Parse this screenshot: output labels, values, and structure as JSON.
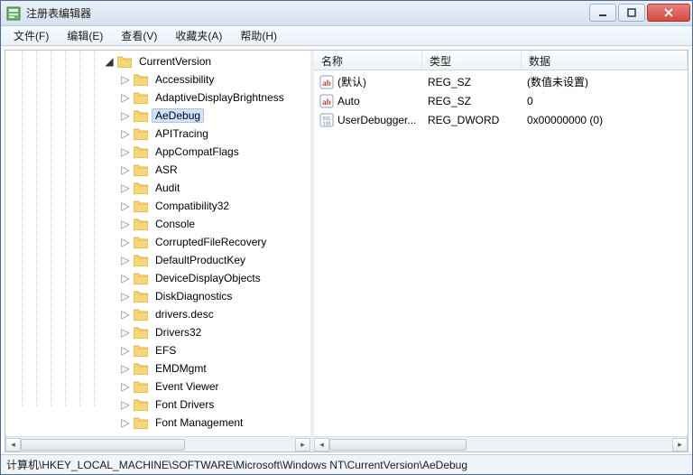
{
  "window": {
    "title": "注册表编辑器"
  },
  "menu": [
    {
      "label": "文件(F)"
    },
    {
      "label": "编辑(E)"
    },
    {
      "label": "查看(V)"
    },
    {
      "label": "收藏夹(A)"
    },
    {
      "label": "帮助(H)"
    }
  ],
  "tree": {
    "parent": {
      "label": "CurrentVersion",
      "expander": "down"
    },
    "children": [
      {
        "label": "Accessibility",
        "selected": false
      },
      {
        "label": "AdaptiveDisplayBrightness",
        "selected": false
      },
      {
        "label": "AeDebug",
        "selected": true
      },
      {
        "label": "APITracing",
        "selected": false
      },
      {
        "label": "AppCompatFlags",
        "selected": false
      },
      {
        "label": "ASR",
        "selected": false
      },
      {
        "label": "Audit",
        "selected": false
      },
      {
        "label": "Compatibility32",
        "selected": false
      },
      {
        "label": "Console",
        "selected": false
      },
      {
        "label": "CorruptedFileRecovery",
        "selected": false
      },
      {
        "label": "DefaultProductKey",
        "selected": false
      },
      {
        "label": "DeviceDisplayObjects",
        "selected": false
      },
      {
        "label": "DiskDiagnostics",
        "selected": false
      },
      {
        "label": "drivers.desc",
        "selected": false
      },
      {
        "label": "Drivers32",
        "selected": false
      },
      {
        "label": "EFS",
        "selected": false
      },
      {
        "label": "EMDMgmt",
        "selected": false
      },
      {
        "label": "Event Viewer",
        "selected": false
      },
      {
        "label": "Font Drivers",
        "selected": false
      },
      {
        "label": "Font Management",
        "selected": false
      }
    ]
  },
  "list": {
    "columns": {
      "name": "名称",
      "type": "类型",
      "data": "数据"
    },
    "rows": [
      {
        "icon": "str",
        "name": "(默认)",
        "type": "REG_SZ",
        "data": "(数值未设置)"
      },
      {
        "icon": "str",
        "name": "Auto",
        "type": "REG_SZ",
        "data": "0"
      },
      {
        "icon": "bin",
        "name": "UserDebugger...",
        "type": "REG_DWORD",
        "data": "0x00000000 (0)"
      }
    ]
  },
  "statusbar": {
    "path": "计算机\\HKEY_LOCAL_MACHINE\\SOFTWARE\\Microsoft\\Windows NT\\CurrentVersion\\AeDebug"
  },
  "icons": {
    "expander_right": "▷",
    "expander_down": "◢"
  }
}
